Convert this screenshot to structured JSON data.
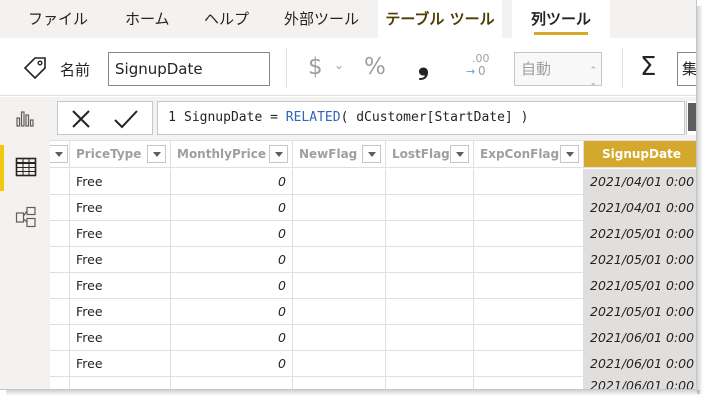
{
  "menu": {
    "items": [
      "ファイル",
      "ホーム",
      "ヘルプ",
      "外部ツール",
      "テーブル ツール",
      "列ツール"
    ]
  },
  "ribbon": {
    "name_label": "名前",
    "name_value": "SignupDate",
    "currency_symbol": "$",
    "percent_symbol": "%",
    "comma_symbol": "❟",
    "decimal_top": ".00",
    "decimal_bottom": "0",
    "auto_label": "自動",
    "sigma_symbol": "Σ",
    "aggregation_value": "集"
  },
  "rail": {
    "icons": [
      "report-view-icon",
      "data-view-icon",
      "model-view-icon"
    ],
    "active_index": 1
  },
  "formula": {
    "line_number": "1",
    "col": "SignupDate",
    "eq": " = ",
    "fn": "RELATED",
    "open": "( ",
    "arg": "dCustomer[StartDate]",
    "close": " )"
  },
  "table": {
    "headers": [
      "PriceType",
      "MonthlyPrice",
      "NewFlag",
      "LostFlag",
      "ExpConFlag",
      "SignupDate"
    ],
    "rows": [
      {
        "price_type": "Free",
        "monthly_price": "0",
        "signup_date": "2021/04/01 0:00"
      },
      {
        "price_type": "Free",
        "monthly_price": "0",
        "signup_date": "2021/04/01 0:00"
      },
      {
        "price_type": "Free",
        "monthly_price": "0",
        "signup_date": "2021/05/01 0:00"
      },
      {
        "price_type": "Free",
        "monthly_price": "0",
        "signup_date": "2021/05/01 0:00"
      },
      {
        "price_type": "Free",
        "monthly_price": "0",
        "signup_date": "2021/05/01 0:00"
      },
      {
        "price_type": "Free",
        "monthly_price": "0",
        "signup_date": "2021/05/01 0:00"
      },
      {
        "price_type": "Free",
        "monthly_price": "0",
        "signup_date": "2021/06/01 0:00"
      },
      {
        "price_type": "Free",
        "monthly_price": "0",
        "signup_date": "2021/06/01 0:00"
      }
    ],
    "partial_row_date": "2021/06/01 0:00"
  },
  "colors": {
    "accent_yellow": "#f2c811",
    "selected_header": "#d4a82c",
    "selected_column": "#e1dfdd",
    "function_blue": "#3165bb"
  }
}
